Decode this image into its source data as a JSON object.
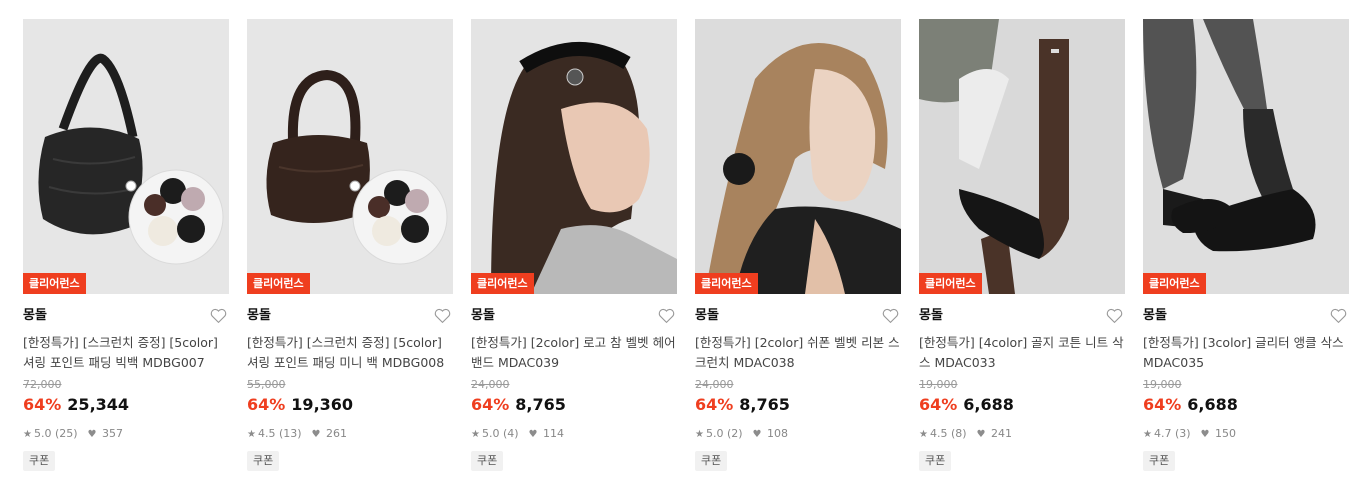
{
  "products": [
    {
      "badge": "클리어런스",
      "brand": "몽돌",
      "title": "[한정특가] [스크런치 증정] [5color] 셔링 포인트 패딩 빅백 MDBG007",
      "orig_price": "72,000",
      "discount": "64%",
      "price": "25,344",
      "rating": "5.0 (25)",
      "likes": "357",
      "coupon": "쿠폰",
      "image": "black-padded-shoulder-bag-with-scrunchies"
    },
    {
      "badge": "클리어런스",
      "brand": "몽돌",
      "title": "[한정특가] [스크런치 증정] [5color] 셔링 포인트 패딩 미니 백 MDBG008",
      "orig_price": "55,000",
      "discount": "64%",
      "price": "19,360",
      "rating": "4.5 (13)",
      "likes": "261",
      "coupon": "쿠폰",
      "image": "brown-padded-mini-bag-with-scrunchies"
    },
    {
      "badge": "클리어런스",
      "brand": "몽돌",
      "title": "[한정특가] [2color] 로고 참 벨벳 헤어밴드 MDAC039",
      "orig_price": "24,000",
      "discount": "64%",
      "price": "8,765",
      "rating": "5.0 (4)",
      "likes": "114",
      "coupon": "쿠폰",
      "image": "model-wearing-velvet-headband"
    },
    {
      "badge": "클리어런스",
      "brand": "몽돌",
      "title": "[한정특가] [2color] 쉬폰 벨벳 리본 스크런치 MDAC038",
      "orig_price": "24,000",
      "discount": "64%",
      "price": "8,765",
      "rating": "5.0 (2)",
      "likes": "108",
      "coupon": "쿠폰",
      "image": "model-with-ribbon-scrunchie"
    },
    {
      "badge": "클리어런스",
      "brand": "몽돌",
      "title": "[한정특가] [4color] 골지 코튼 니트 삭스 MDAC033",
      "orig_price": "19,000",
      "discount": "64%",
      "price": "6,688",
      "rating": "4.5 (8)",
      "likes": "241",
      "coupon": "쿠폰",
      "image": "brown-ribbed-knit-socks"
    },
    {
      "badge": "클리어런스",
      "brand": "몽돌",
      "title": "[한정특가] [3color] 글리터 앵클 삭스 MDAC035",
      "orig_price": "19,000",
      "discount": "64%",
      "price": "6,688",
      "rating": "4.7 (3)",
      "likes": "150",
      "coupon": "쿠폰",
      "image": "glitter-ankle-socks-with-loafers"
    }
  ],
  "colors": {
    "badge": "#ef3e1f",
    "discount": "#ef3e1f"
  }
}
